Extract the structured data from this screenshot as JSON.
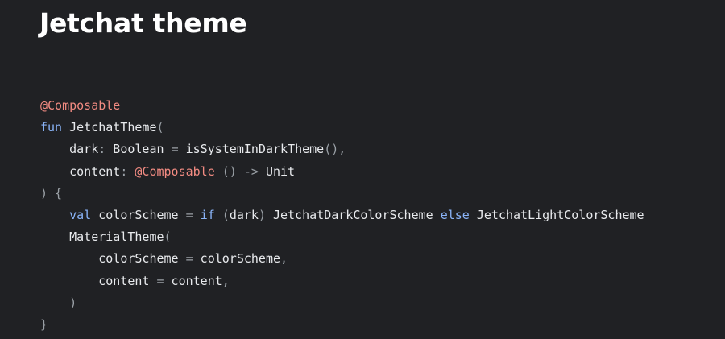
{
  "slide": {
    "title": "Jetchat theme"
  },
  "code": {
    "language": "kotlin",
    "colors": {
      "background": "#202124",
      "title": "#ffffff",
      "plain": "#e8eaed",
      "annotation": "#f28b82",
      "keyword": "#8ab4f8",
      "punctuation": "#9aa0a6"
    },
    "lines": [
      [
        {
          "t": "annotation",
          "v": "@Composable"
        }
      ],
      [
        {
          "t": "keyword",
          "v": "fun"
        },
        {
          "t": "plain",
          "v": " JetchatTheme"
        },
        {
          "t": "punct",
          "v": "("
        }
      ],
      [
        {
          "t": "plain",
          "v": "    dark"
        },
        {
          "t": "punct",
          "v": ":"
        },
        {
          "t": "plain",
          "v": " Boolean "
        },
        {
          "t": "punct",
          "v": "="
        },
        {
          "t": "plain",
          "v": " isSystemInDarkTheme"
        },
        {
          "t": "punct",
          "v": "(),"
        }
      ],
      [
        {
          "t": "plain",
          "v": "    content"
        },
        {
          "t": "punct",
          "v": ":"
        },
        {
          "t": "plain",
          "v": " "
        },
        {
          "t": "annotation",
          "v": "@Composable"
        },
        {
          "t": "plain",
          "v": " "
        },
        {
          "t": "punct",
          "v": "() ->"
        },
        {
          "t": "plain",
          "v": " Unit"
        }
      ],
      [
        {
          "t": "punct",
          "v": ") {"
        }
      ],
      [
        {
          "t": "plain",
          "v": "    "
        },
        {
          "t": "keyword",
          "v": "val"
        },
        {
          "t": "plain",
          "v": " colorScheme "
        },
        {
          "t": "punct",
          "v": "="
        },
        {
          "t": "plain",
          "v": " "
        },
        {
          "t": "keyword",
          "v": "if"
        },
        {
          "t": "plain",
          "v": " "
        },
        {
          "t": "punct",
          "v": "("
        },
        {
          "t": "plain",
          "v": "dark"
        },
        {
          "t": "punct",
          "v": ")"
        },
        {
          "t": "plain",
          "v": " JetchatDarkColorScheme "
        },
        {
          "t": "keyword",
          "v": "else"
        },
        {
          "t": "plain",
          "v": " JetchatLightColorScheme"
        }
      ],
      [
        {
          "t": "plain",
          "v": "    MaterialTheme"
        },
        {
          "t": "punct",
          "v": "("
        }
      ],
      [
        {
          "t": "plain",
          "v": "        colorScheme "
        },
        {
          "t": "punct",
          "v": "="
        },
        {
          "t": "plain",
          "v": " colorScheme"
        },
        {
          "t": "punct",
          "v": ","
        }
      ],
      [
        {
          "t": "plain",
          "v": "        content "
        },
        {
          "t": "punct",
          "v": "="
        },
        {
          "t": "plain",
          "v": " content"
        },
        {
          "t": "punct",
          "v": ","
        }
      ],
      [
        {
          "t": "punct",
          "v": "    )"
        }
      ],
      [
        {
          "t": "punct",
          "v": "}"
        }
      ]
    ]
  }
}
